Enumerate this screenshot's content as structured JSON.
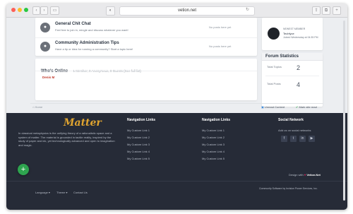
{
  "browser": {
    "url": "vetion.net",
    "nav_back": "‹",
    "nav_forward": "›",
    "sidebar_toggle": "▭",
    "shield": "◐",
    "reload": "↻",
    "share": "⇪",
    "tabs": "⧉",
    "add_tab": "+"
  },
  "forums": [
    {
      "title": "General Chit Chat",
      "desc": "Feel free to join in, mingle and discuss whatever you want!",
      "meta": "No posts here yet"
    },
    {
      "title": "Community Administration Tips",
      "desc": "Have a tip or idea for running a community? Start a topic here!",
      "meta": "No posts here yet"
    }
  ],
  "online": {
    "title": "Who's Online",
    "summary": "1 Member, 0 Anonymous, 8 Guests (See full list)",
    "member": "Denis M"
  },
  "newest_member": {
    "label": "NEWEST MEMBER",
    "name": "Techfyce",
    "joined": "Joined Wednesday at 04:35 PM"
  },
  "forum_stats": {
    "title": "Forum Statistics",
    "topics_label": "Total Topics",
    "topics_value": "2",
    "posts_label": "Total Posts",
    "posts_value": "4"
  },
  "breadcrumb_home": "Home",
  "bottom_actions": {
    "unread": "Unread Content",
    "mark_read": "Mark site read"
  },
  "footer": {
    "brand": "Matter",
    "about": "In classical metaphysics is the unifying theory of a rationalistic space and a system of matter. The material is grounded in tactile reality, inspired by the study of paper and ink, yet technologically advanced and open to imagination and magic.",
    "nav1": {
      "title": "Navigation Links",
      "links": [
        "My Custom Link 1",
        "My Custom Link 2",
        "My Custom Link 3",
        "My Custom Link 4",
        "My Custom Link 5"
      ]
    },
    "nav2": {
      "title": "Navigation Links",
      "links": [
        "My Custom Link 1",
        "My Custom Link 2",
        "My Custom Link 3",
        "My Custom Link 4",
        "My Custom Link 5"
      ]
    },
    "social": {
      "title": "Social Network",
      "text": "Add us on social networks",
      "icons": [
        "f",
        "t",
        "in",
        "▶"
      ]
    },
    "design_with": "Design with",
    "design_by": "Vetion.Net",
    "bottom_links": [
      "Language ▾",
      "Theme ▾",
      "Contact Us"
    ],
    "credit": "Community Software by Invision Power Services, Inc."
  },
  "fab_label": "+",
  "colors": {
    "accent_orange": "#e0a42f",
    "heart": "#e0245e",
    "fab": "#2ea44f",
    "member_red": "#c0392b"
  }
}
